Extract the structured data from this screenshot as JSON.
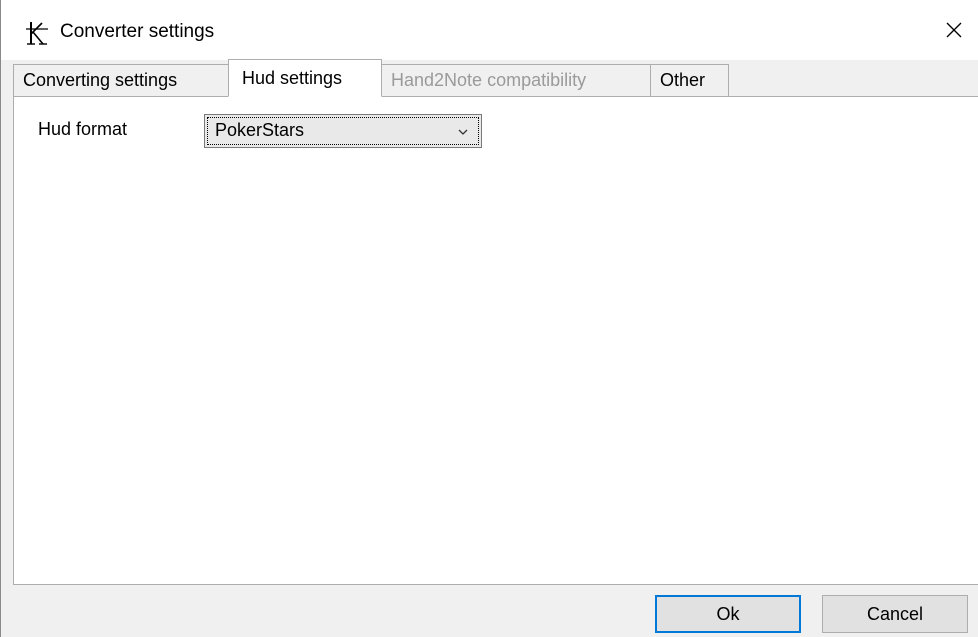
{
  "window": {
    "title": "Converter settings",
    "app_icon": "k-logo-icon",
    "close_icon": "close-icon"
  },
  "tabs": [
    {
      "label": "Converting settings",
      "state": "normal"
    },
    {
      "label": "Hud settings",
      "state": "active"
    },
    {
      "label": "Hand2Note compatibility",
      "state": "disabled"
    },
    {
      "label": "Other",
      "state": "normal"
    }
  ],
  "hud": {
    "format_label": "Hud format",
    "format_value": "PokerStars",
    "dropdown_icon": "chevron-down-icon"
  },
  "buttons": {
    "ok_label": "Ok",
    "cancel_label": "Cancel"
  },
  "colors": {
    "accent": "#0078d7",
    "disabled_text": "#9a9a9a",
    "panel_bg": "#ffffff",
    "window_bg": "#f0f0f0"
  }
}
